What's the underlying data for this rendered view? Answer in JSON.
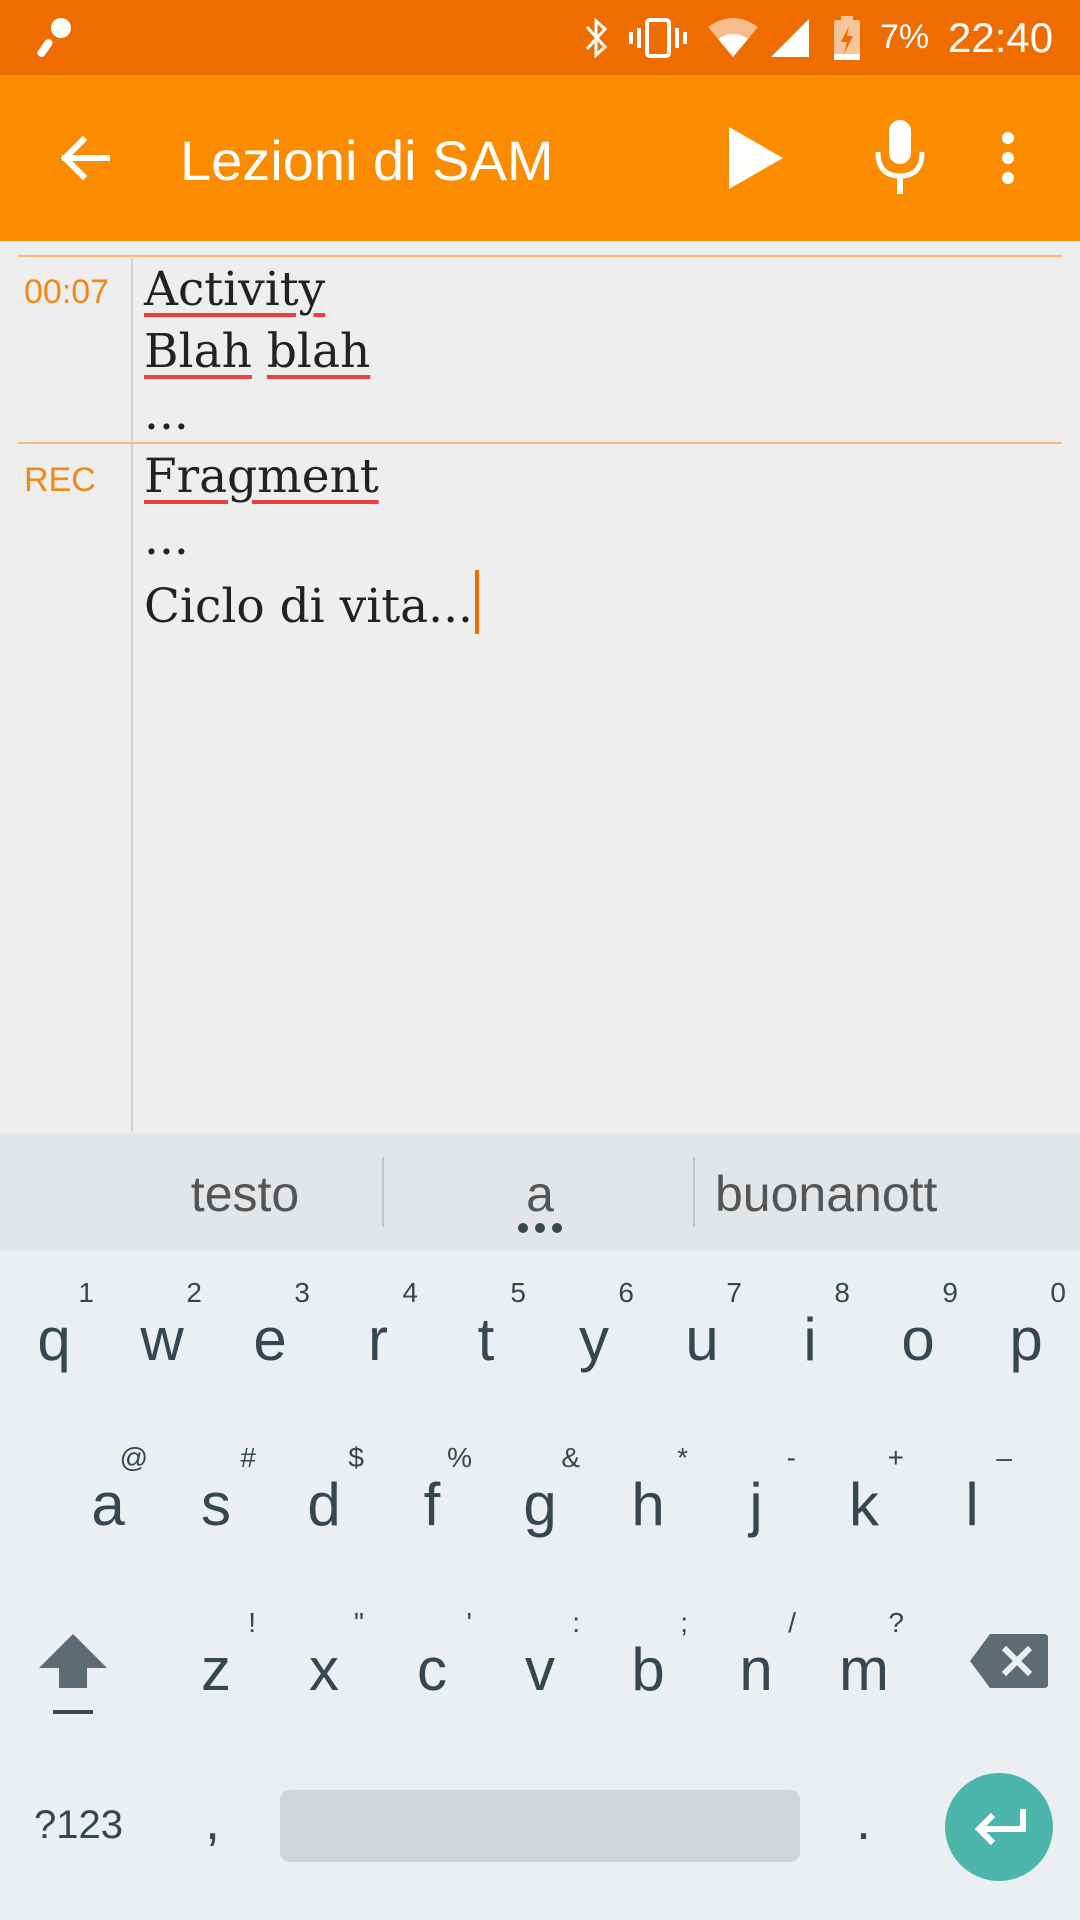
{
  "status_bar": {
    "battery_percent": "7%",
    "time": "22:40",
    "icons": [
      "app-notification-icon",
      "bluetooth-icon",
      "vibrate-icon",
      "wifi-icon",
      "signal-icon",
      "battery-charging-icon"
    ]
  },
  "app_bar": {
    "title": "Lezioni di SAM",
    "accent_color": "#fb8c00",
    "status_color": "#ee6c00"
  },
  "notes": {
    "entries": [
      {
        "timestamp": "00:07",
        "lines": [
          "Activity",
          "Blah blah",
          "..."
        ]
      },
      {
        "timestamp": "REC",
        "lines": [
          "Fragment",
          "...",
          "Ciclo di vita..."
        ]
      }
    ]
  },
  "keyboard": {
    "suggestions": [
      "testo",
      "a",
      "buonanott"
    ],
    "row1": [
      {
        "key": "q",
        "hint": "1"
      },
      {
        "key": "w",
        "hint": "2"
      },
      {
        "key": "e",
        "hint": "3"
      },
      {
        "key": "r",
        "hint": "4"
      },
      {
        "key": "t",
        "hint": "5"
      },
      {
        "key": "y",
        "hint": "6"
      },
      {
        "key": "u",
        "hint": "7"
      },
      {
        "key": "i",
        "hint": "8"
      },
      {
        "key": "o",
        "hint": "9"
      },
      {
        "key": "p",
        "hint": "0"
      }
    ],
    "row2": [
      {
        "key": "a",
        "hint": "@"
      },
      {
        "key": "s",
        "hint": "#"
      },
      {
        "key": "d",
        "hint": "$"
      },
      {
        "key": "f",
        "hint": "%"
      },
      {
        "key": "g",
        "hint": "&"
      },
      {
        "key": "h",
        "hint": "*"
      },
      {
        "key": "j",
        "hint": "-"
      },
      {
        "key": "k",
        "hint": "+"
      },
      {
        "key": "l",
        "hint": "–"
      }
    ],
    "row3": [
      {
        "key": "z",
        "hint": "!"
      },
      {
        "key": "x",
        "hint": "\""
      },
      {
        "key": "c",
        "hint": "'"
      },
      {
        "key": "v",
        "hint": ":"
      },
      {
        "key": "b",
        "hint": ";"
      },
      {
        "key": "n",
        "hint": "/"
      },
      {
        "key": "m",
        "hint": "?"
      }
    ],
    "symbols_label": "?123",
    "comma": ",",
    "period": ".",
    "enter_color": "#4db6ac"
  }
}
